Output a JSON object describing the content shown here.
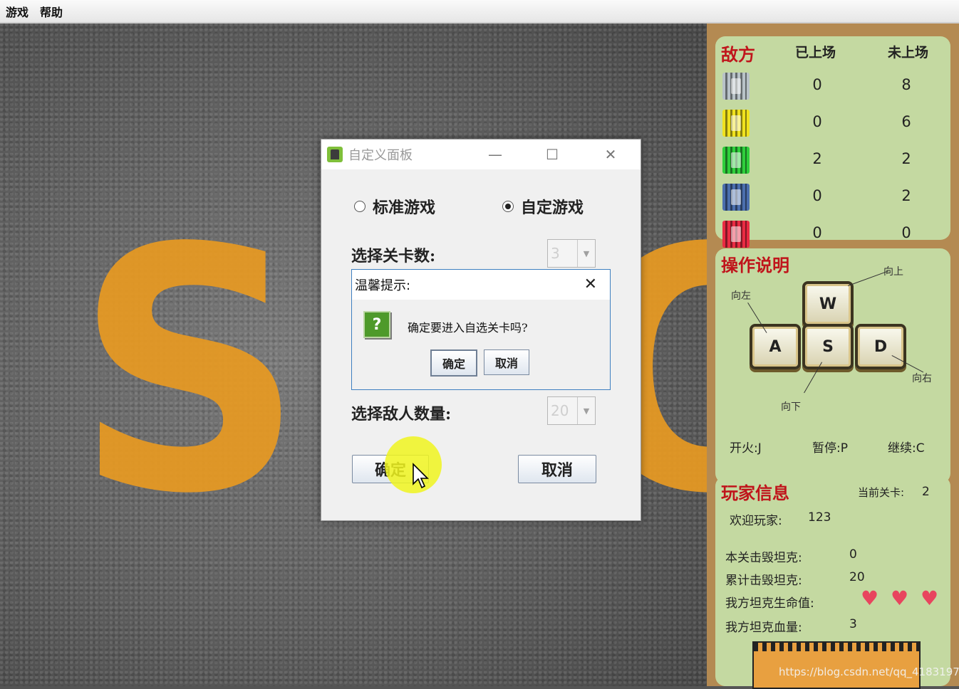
{
  "menubar": {
    "items": [
      "游戏",
      "帮助"
    ]
  },
  "background": {
    "sign_text": "STOP"
  },
  "enemy_panel": {
    "title": "敌方",
    "col_on": "已上场",
    "col_off": "未上场",
    "rows": [
      {
        "color": "#b8c2c8",
        "on": "0",
        "off": "8"
      },
      {
        "color": "#f0e21e",
        "on": "0",
        "off": "6"
      },
      {
        "color": "#2fcf3c",
        "on": "2",
        "off": "2"
      },
      {
        "color": "#4b6fae",
        "on": "0",
        "off": "2"
      },
      {
        "color": "#ea2b43",
        "on": "0",
        "off": "0"
      }
    ]
  },
  "ops_panel": {
    "title": "操作说明",
    "keys": [
      "W",
      "A",
      "S",
      "D"
    ],
    "labels": {
      "up": "向上",
      "left": "向左",
      "right": "向右",
      "down": "向下"
    },
    "fire": "开火:J",
    "pause": "暂停:P",
    "resume": "继续:C"
  },
  "player_panel": {
    "title": "玩家信息",
    "level_label": "当前关卡:",
    "level": "2",
    "welcome_label": "欢迎玩家:",
    "player_name": "123",
    "kills_level_label": "本关击毁坦克:",
    "kills_level": "0",
    "kills_total_label": "累计击毁坦克:",
    "kills_total": "20",
    "lives_label": "我方坦克生命值:",
    "lives": 3,
    "hp_label": "我方坦克血量:",
    "hp": "3"
  },
  "custom_dialog": {
    "title": "自定义面板",
    "radio_standard": "标准游戏",
    "radio_custom": "自定游戏",
    "selected": "custom",
    "level_label": "选择关卡数:",
    "level_value": "3",
    "enemy_label": "选择敌人数量:",
    "enemy_value": "20",
    "ok": "确定",
    "cancel": "取消"
  },
  "confirm_dialog": {
    "title": "温馨提示:",
    "icon": "question-icon",
    "message": "确定要进入自选关卡吗?",
    "ok": "确定",
    "cancel": "取消"
  },
  "watermark": "https://blog.csdn.net/qq_41831975"
}
